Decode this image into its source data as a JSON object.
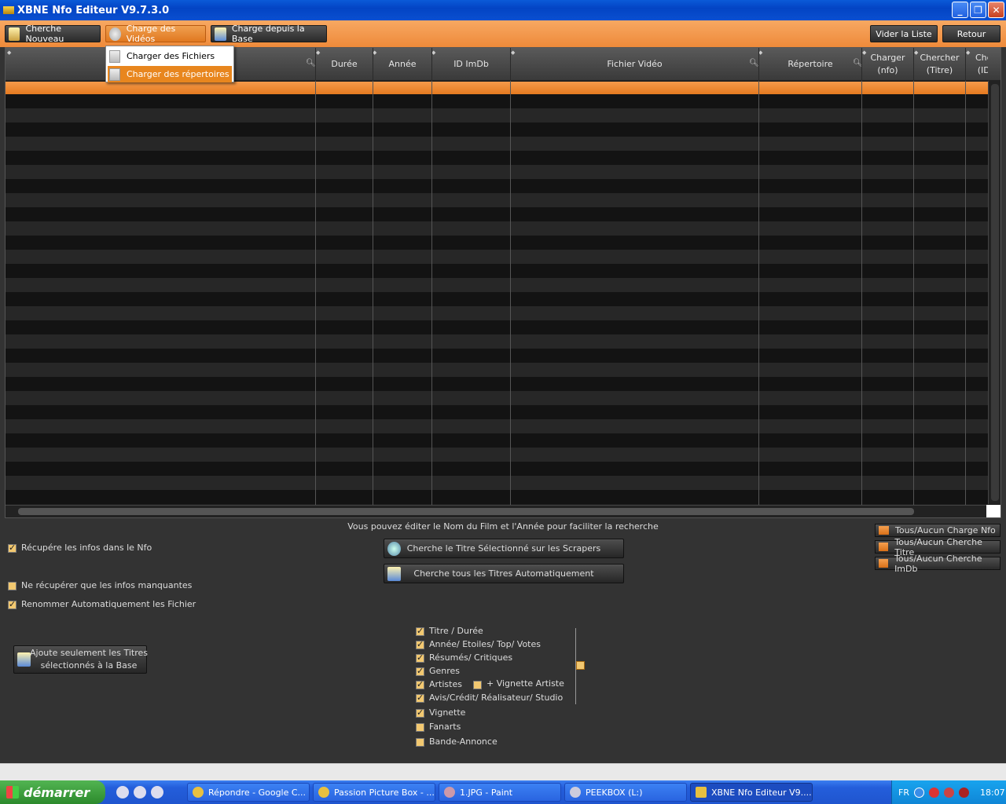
{
  "window": {
    "title": "XBNE Nfo Editeur V9.7.3.0",
    "minimize": "_",
    "maximize": "❐",
    "close": "✕"
  },
  "toolbar": {
    "cherche_nouveau": "Cherche Nouveau",
    "charge_videos": "Charge des Vidéos",
    "charge_base": "Charge depuis la Base",
    "vider_liste": "Vider la Liste",
    "retour": "Retour"
  },
  "menu": {
    "items": [
      "Charger des Fichiers",
      "Charger des répertoires"
    ]
  },
  "grid": {
    "columns": [
      "",
      "Durée",
      "Année",
      "ID ImDb",
      "Fichier Vidéo",
      "Répertoire",
      "Charger\n(nfo)",
      "Chercher\n(Titre)",
      "Che\n(ID"
    ]
  },
  "info_text": "Vous pouvez éditer le Nom du Film et l'Année pour faciliter la recherche",
  "actions": {
    "cherche_selectionne": "Cherche le Titre Sélectionné sur les Scrapers",
    "cherche_tous": "Cherche tous les Titres Automatiquement",
    "ajoute_base": "Ajoute seulement les Titres\nsélectionnés à la Base"
  },
  "options": [
    {
      "label": "Récupére les infos dans le Nfo",
      "checked": true
    },
    {
      "label": "Ne récupérer que les infos manquantes",
      "checked": false
    },
    {
      "label": "Renommer Automatiquement les Fichier",
      "checked": true
    }
  ],
  "toggles": [
    "Tous/Aucun Charge Nfo",
    "Tous/Aucun Cherche Titre",
    "Tous/Aucun Cherche ImDb"
  ],
  "scrape_options": [
    {
      "label": "Titre / Durée",
      "checked": true
    },
    {
      "label": "Année/ Etoiles/ Top/ Votes",
      "checked": true
    },
    {
      "label": "Résumés/ Critiques",
      "checked": true
    },
    {
      "label": "Genres",
      "checked": true
    },
    {
      "label": "Artistes",
      "checked": true
    },
    {
      "label": "Avis/Crédit/ Réalisateur/ Studio",
      "checked": true
    },
    {
      "label": "Vignette",
      "checked": true
    },
    {
      "label": "Fanarts",
      "checked": false
    },
    {
      "label": "Bande-Annonce",
      "checked": false
    }
  ],
  "vignette_artiste": {
    "label": "+ Vignette Artiste",
    "checked": false
  },
  "taskbar": {
    "start": "démarrer",
    "tasks": [
      "Répondre - Google C...",
      "Passion Picture Box - ...",
      "1.JPG - Paint",
      "PEEKBOX (L:)",
      "XBNE Nfo Editeur V9...."
    ],
    "lang": "FR",
    "clock": "18:07"
  },
  "colors": {
    "accent": "#ee8a3a",
    "title_blue": "#0a5ad8",
    "grid_bg": "#1d1d1d"
  }
}
